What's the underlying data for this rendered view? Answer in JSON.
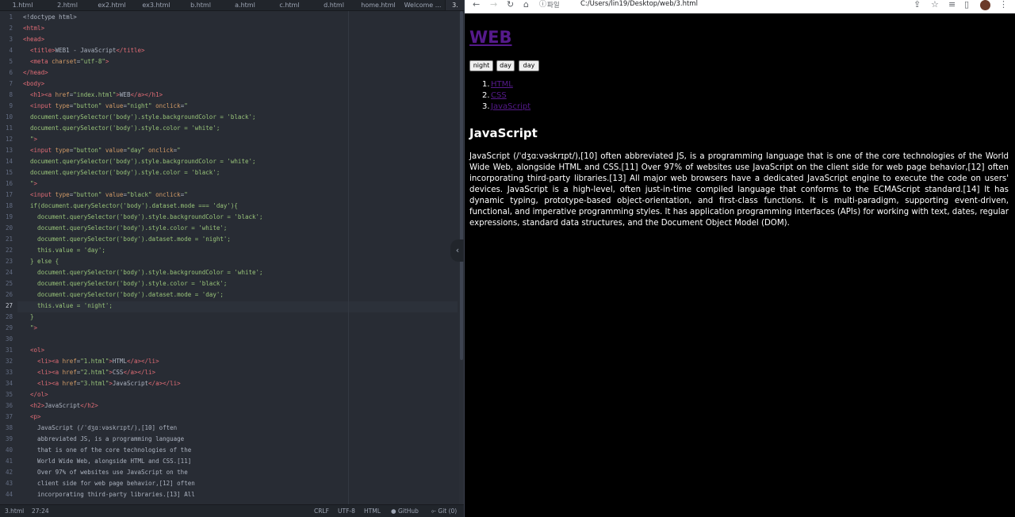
{
  "editor": {
    "tabs": [
      "1.html",
      "2.html",
      "ex2.html",
      "ex3.html",
      "b.html",
      "a.html",
      "c.html",
      "d.html",
      "home.html",
      "Welcome ...",
      "3."
    ],
    "active_tab_index": 10,
    "line_numbers": [
      "1",
      "2",
      "3",
      "4",
      "5",
      "6",
      "7",
      "8",
      "9",
      "10",
      "11",
      "12",
      "13",
      "14",
      "15",
      "16",
      "17",
      "18",
      "19",
      "20",
      "21",
      "22",
      "23",
      "24",
      "25",
      "26",
      "27",
      "28",
      "29",
      "30",
      "31",
      "32",
      "33",
      "34",
      "35",
      "36",
      "37",
      "38",
      "39",
      "40",
      "41",
      "42",
      "43",
      "44"
    ],
    "current_line": 27,
    "lines": [
      [
        [
          "t-txt",
          "<!doctype html>"
        ]
      ],
      [
        [
          "t-tag",
          "<html>"
        ]
      ],
      [
        [
          "t-tag",
          "<head>"
        ]
      ],
      [
        [
          "t-txt",
          "  "
        ],
        [
          "t-tag",
          "<title>"
        ],
        [
          "t-txt",
          "WEB1 - JavaScript"
        ],
        [
          "t-tag",
          "</title>"
        ]
      ],
      [
        [
          "t-txt",
          "  "
        ],
        [
          "t-tag",
          "<meta "
        ],
        [
          "t-attr",
          "charset"
        ],
        [
          "t-txt",
          "="
        ],
        [
          "t-str",
          "\"utf-8\""
        ],
        [
          "t-tag",
          ">"
        ]
      ],
      [
        [
          "t-tag",
          "</head>"
        ]
      ],
      [
        [
          "t-tag",
          "<body>"
        ]
      ],
      [
        [
          "t-txt",
          "  "
        ],
        [
          "t-tag",
          "<h1><a "
        ],
        [
          "t-attr",
          "href"
        ],
        [
          "t-txt",
          "="
        ],
        [
          "t-str",
          "\"index.html\""
        ],
        [
          "t-tag",
          ">"
        ],
        [
          "t-txt",
          "WEB"
        ],
        [
          "t-tag",
          "</a></h1>"
        ]
      ],
      [
        [
          "t-txt",
          "  "
        ],
        [
          "t-tag",
          "<input "
        ],
        [
          "t-attr",
          "type"
        ],
        [
          "t-txt",
          "="
        ],
        [
          "t-str",
          "\"button\""
        ],
        [
          "t-attr",
          " value"
        ],
        [
          "t-txt",
          "="
        ],
        [
          "t-str",
          "\"night\""
        ],
        [
          "t-attr",
          " onclick"
        ],
        [
          "t-txt",
          "="
        ],
        [
          "t-str",
          "\""
        ]
      ],
      [
        [
          "t-str",
          "  document.querySelector('body').style.backgroundColor = 'black';"
        ]
      ],
      [
        [
          "t-str",
          "  document.querySelector('body').style.color = 'white';"
        ]
      ],
      [
        [
          "t-str",
          "  \""
        ],
        [
          "t-tag",
          ">"
        ]
      ],
      [
        [
          "t-txt",
          "  "
        ],
        [
          "t-tag",
          "<input "
        ],
        [
          "t-attr",
          "type"
        ],
        [
          "t-txt",
          "="
        ],
        [
          "t-str",
          "\"button\""
        ],
        [
          "t-attr",
          " value"
        ],
        [
          "t-txt",
          "="
        ],
        [
          "t-str",
          "\"day\""
        ],
        [
          "t-attr",
          " onclick"
        ],
        [
          "t-txt",
          "="
        ],
        [
          "t-str",
          "\""
        ]
      ],
      [
        [
          "t-str",
          "  document.querySelector('body').style.backgroundColor = 'white';"
        ]
      ],
      [
        [
          "t-str",
          "  document.querySelector('body').style.color = 'black';"
        ]
      ],
      [
        [
          "t-str",
          "  \""
        ],
        [
          "t-tag",
          ">"
        ]
      ],
      [
        [
          "t-txt",
          "  "
        ],
        [
          "t-tag",
          "<input "
        ],
        [
          "t-attr",
          "type"
        ],
        [
          "t-txt",
          "="
        ],
        [
          "t-str",
          "\"button\""
        ],
        [
          "t-attr",
          " value"
        ],
        [
          "t-txt",
          "="
        ],
        [
          "t-str",
          "\"black\""
        ],
        [
          "t-attr",
          " onclick"
        ],
        [
          "t-txt",
          "="
        ],
        [
          "t-str",
          "\""
        ]
      ],
      [
        [
          "t-str",
          "  if(document.querySelector('body').dataset.mode === 'day'){"
        ]
      ],
      [
        [
          "t-str",
          "    document.querySelector('body').style.backgroundColor = 'black';"
        ]
      ],
      [
        [
          "t-str",
          "    document.querySelector('body').style.color = 'white';"
        ]
      ],
      [
        [
          "t-str",
          "    document.querySelector('body').dataset.mode = 'night';"
        ]
      ],
      [
        [
          "t-str",
          "    this.value = 'day';"
        ]
      ],
      [
        [
          "t-str",
          "  } else {"
        ]
      ],
      [
        [
          "t-str",
          "    document.querySelector('body').style.backgroundColor = 'white';"
        ]
      ],
      [
        [
          "t-str",
          "    document.querySelector('body').style.color = 'black';"
        ]
      ],
      [
        [
          "t-str",
          "    document.querySelector('body').dataset.mode = 'day';"
        ]
      ],
      [
        [
          "t-str",
          "    this.value = 'night';"
        ]
      ],
      [
        [
          "t-str",
          "  }"
        ]
      ],
      [
        [
          "t-str",
          "  \""
        ],
        [
          "t-tag",
          ">"
        ]
      ],
      [
        [
          "t-txt",
          ""
        ]
      ],
      [
        [
          "t-txt",
          "  "
        ],
        [
          "t-tag",
          "<ol>"
        ]
      ],
      [
        [
          "t-txt",
          "    "
        ],
        [
          "t-tag",
          "<li><a "
        ],
        [
          "t-attr",
          "href"
        ],
        [
          "t-txt",
          "="
        ],
        [
          "t-str",
          "\"1.html\""
        ],
        [
          "t-tag",
          ">"
        ],
        [
          "t-txt",
          "HTML"
        ],
        [
          "t-tag",
          "</a></li>"
        ]
      ],
      [
        [
          "t-txt",
          "    "
        ],
        [
          "t-tag",
          "<li><a "
        ],
        [
          "t-attr",
          "href"
        ],
        [
          "t-txt",
          "="
        ],
        [
          "t-str",
          "\"2.html\""
        ],
        [
          "t-tag",
          ">"
        ],
        [
          "t-txt",
          "CSS"
        ],
        [
          "t-tag",
          "</a></li>"
        ]
      ],
      [
        [
          "t-txt",
          "    "
        ],
        [
          "t-tag",
          "<li><a "
        ],
        [
          "t-attr",
          "href"
        ],
        [
          "t-txt",
          "="
        ],
        [
          "t-str",
          "\"3.html\""
        ],
        [
          "t-tag",
          ">"
        ],
        [
          "t-txt",
          "JavaScript"
        ],
        [
          "t-tag",
          "</a></li>"
        ]
      ],
      [
        [
          "t-txt",
          "  "
        ],
        [
          "t-tag",
          "</ol>"
        ]
      ],
      [
        [
          "t-txt",
          "  "
        ],
        [
          "t-tag",
          "<h2>"
        ],
        [
          "t-txt",
          "JavaScript"
        ],
        [
          "t-tag",
          "</h2>"
        ]
      ],
      [
        [
          "t-txt",
          "  "
        ],
        [
          "t-tag",
          "<p>"
        ]
      ],
      [
        [
          "t-txt",
          "    JavaScript (/ˈdʒɑːvəskrɪpt/),[10] often"
        ]
      ],
      [
        [
          "t-txt",
          "    abbreviated JS, is a programming language"
        ]
      ],
      [
        [
          "t-txt",
          "    that is one of the core technologies of the"
        ]
      ],
      [
        [
          "t-txt",
          "    World Wide Web, alongside HTML and CSS.[11]"
        ]
      ],
      [
        [
          "t-txt",
          "    Over 97% of websites use JavaScript on the"
        ]
      ],
      [
        [
          "t-txt",
          "    client side for web page behavior,[12] often"
        ]
      ],
      [
        [
          "t-txt",
          "    incorporating third-party libraries.[13] All"
        ]
      ]
    ],
    "status": {
      "file": "3.html",
      "cursor": "27:24",
      "line_ending": "CRLF",
      "encoding": "UTF-8",
      "grammar": "HTML",
      "github": "GitHub",
      "git": "Git (0)"
    }
  },
  "browser": {
    "address_label": "파일",
    "url": "C:/Users/lin19/Desktop/web/3.html",
    "page": {
      "title_link": "WEB",
      "buttons": [
        "night",
        "day",
        "day"
      ],
      "list": [
        {
          "num": "1.",
          "label": "HTML"
        },
        {
          "num": "2.",
          "label": "CSS"
        },
        {
          "num": "3.",
          "label": "JavaScript"
        }
      ],
      "heading": "JavaScript",
      "paragraph": "JavaScript (/ˈdʒɑːvəskrɪpt/),[10] often abbreviated JS, is a programming language that is one of the core technologies of the World Wide Web, alongside HTML and CSS.[11] Over 97% of websites use JavaScript on the client side for web page behavior,[12] often incorporating third-party libraries.[13] All major web browsers have a dedicated JavaScript engine to execute the code on users' devices. JavaScript is a high-level, often just-in-time compiled language that conforms to the ECMAScript standard.[14] It has dynamic typing, prototype-based object-orientation, and first-class functions. It is multi-paradigm, supporting event-driven, functional, and imperative programming styles. It has application programming interfaces (APIs) for working with text, dates, regular expressions, standard data structures, and the Document Object Model (DOM)."
    }
  },
  "colors": {
    "editor_bg": "#282c34",
    "tag": "#e06c75",
    "attr": "#d19a66",
    "string": "#98c379",
    "link_visited": "#551a8b"
  }
}
